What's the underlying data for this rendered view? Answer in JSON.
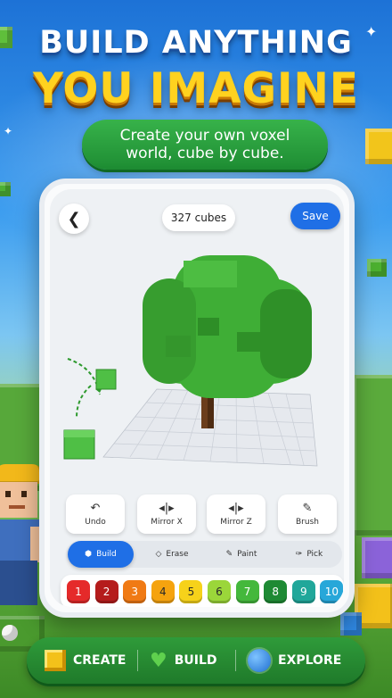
{
  "promo": {
    "headline_line1": "BUILD ANYTHING",
    "headline_line2": "YOU IMAGINE",
    "subtitle": "Create your own voxel world, cube by cube."
  },
  "editor": {
    "back_icon": "chevron-left-icon",
    "cube_count": "327 cubes",
    "save_label": "Save",
    "tools": [
      {
        "label": "Undo",
        "icon": "undo-icon"
      },
      {
        "label": "Mirror X",
        "icon": "mirror-x-icon"
      },
      {
        "label": "Mirror Z",
        "icon": "mirror-z-icon"
      },
      {
        "label": "Brush",
        "icon": "brush-icon"
      }
    ],
    "modes": [
      {
        "label": "Build",
        "icon": "hexagon-icon",
        "active": true
      },
      {
        "label": "Erase",
        "icon": "eraser-icon",
        "active": false
      },
      {
        "label": "Paint",
        "icon": "paint-icon",
        "active": false
      },
      {
        "label": "Pick",
        "icon": "picker-icon",
        "active": false
      }
    ],
    "palette": [
      {
        "label": "1",
        "color": "#e52a2a"
      },
      {
        "label": "2",
        "color": "#b51c1c"
      },
      {
        "label": "3",
        "color": "#f07a14"
      },
      {
        "label": "4",
        "color": "#f5a30f"
      },
      {
        "label": "5",
        "color": "#f6d21a"
      },
      {
        "label": "6",
        "color": "#9bd63a"
      },
      {
        "label": "7",
        "color": "#44b83c"
      },
      {
        "label": "8",
        "color": "#1e8a34"
      },
      {
        "label": "9",
        "color": "#21a79a"
      },
      {
        "label": "10",
        "color": "#27a7d9"
      }
    ]
  },
  "bottom_nav": [
    {
      "label": "CREATE",
      "icon": "cube-icon"
    },
    {
      "label": "BUILD",
      "icon": "heart-voxel-icon"
    },
    {
      "label": "EXPLORE",
      "icon": "planet-icon"
    }
  ],
  "colors": {
    "accent_blue": "#1f6fe6",
    "headline_yellow": "#ffd21f",
    "tree_green": "#3fae36",
    "trunk_brown": "#6b3d1c"
  }
}
